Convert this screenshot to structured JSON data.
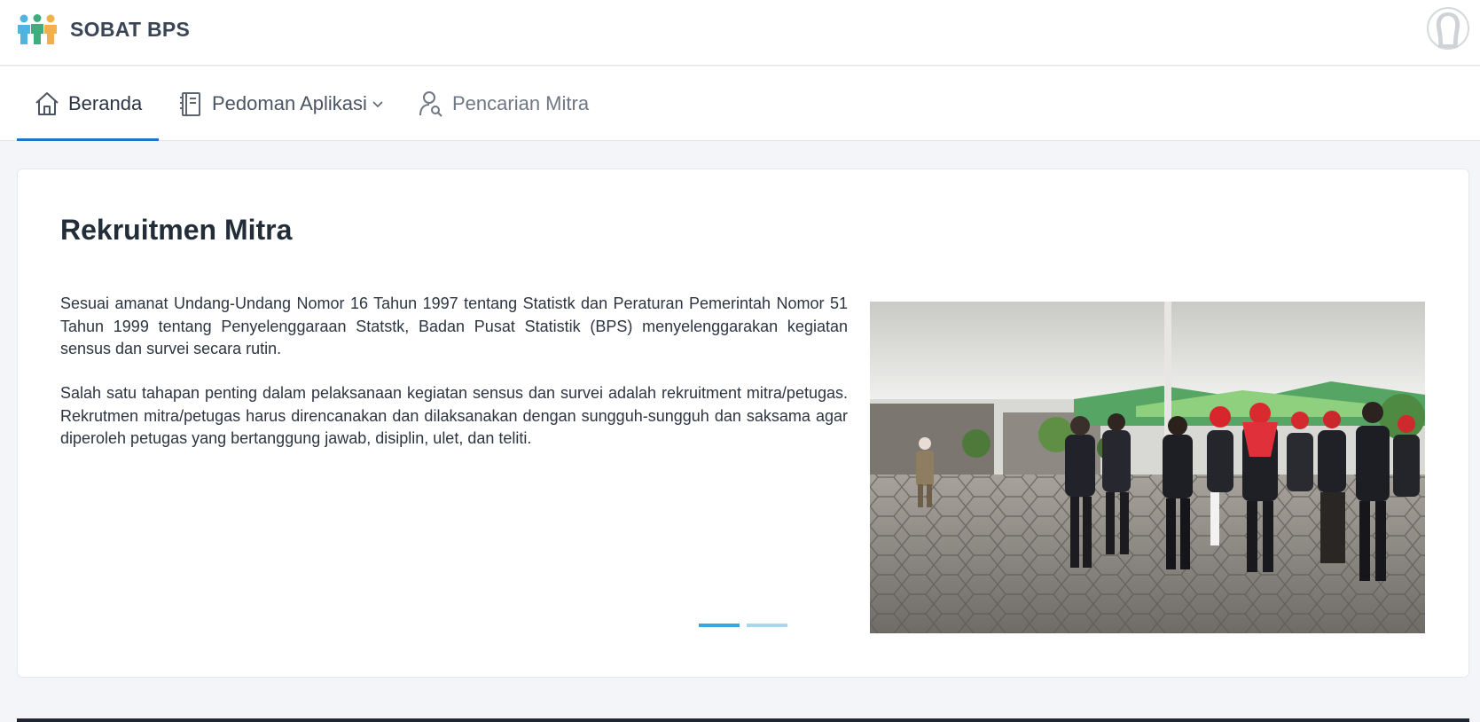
{
  "app": {
    "name": "SOBAT BPS",
    "logo_icon": "people-group-icon",
    "avatar_icon": "user-avatar-icon"
  },
  "nav": {
    "items": [
      {
        "label": "Beranda",
        "icon": "home-icon",
        "active": true
      },
      {
        "label": "Pedoman Aplikasi",
        "icon": "book-icon",
        "dropdown": true
      },
      {
        "label": "Pencarian Mitra",
        "icon": "user-search-icon"
      }
    ]
  },
  "main": {
    "title": "Rekruitmen Mitra",
    "paragraphs": [
      "Sesuai amanat Undang-Undang Nomor 16 Tahun 1997 tentang Statistk dan Peraturan Pemerintah Nomor 51 Tahun 1999 tentang Penyelenggaraan Statstk, Badan Pusat Statistik (BPS) menyelenggarakan kegiatan sensus dan survei secara rutin.",
      "Salah satu tahapan penting dalam pelaksanaan kegiatan sensus dan survei adalah rekruitment mitra/petugas. Rekrutmen mitra/petugas harus direncanakan dan dilaksanakan dengan sungguh-sungguh dan saksama agar diperoleh petugas yang bertanggung jawab, disiplin, ulet, dan teliti."
    ],
    "carousel": {
      "slides": 2,
      "active_index": 0
    }
  },
  "colors": {
    "accent": "#1d74c9",
    "indicator_active": "#3aa7d8",
    "indicator_inactive": "#a8d8ee"
  }
}
